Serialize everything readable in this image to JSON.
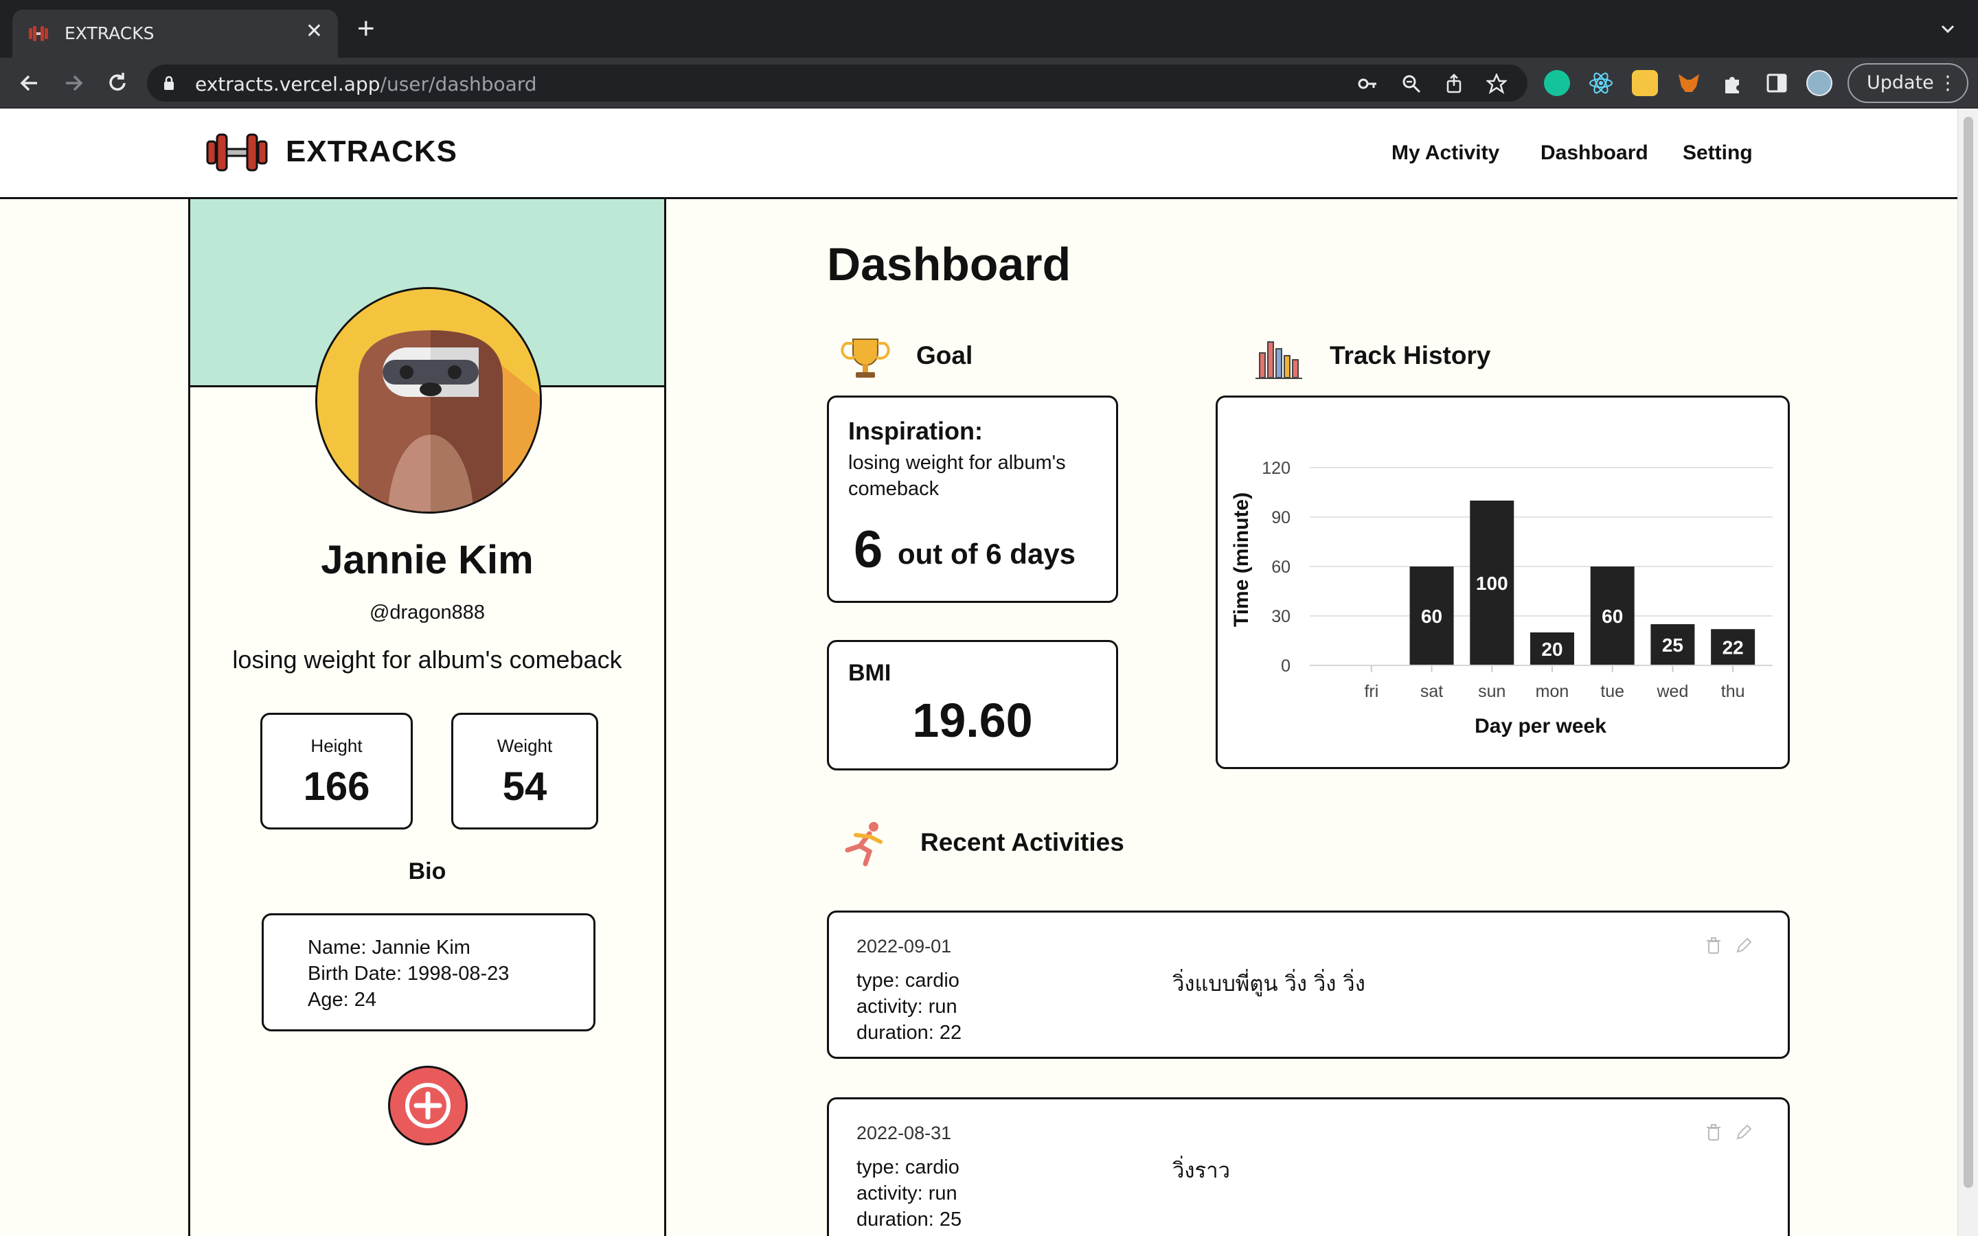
{
  "browser": {
    "tab_title": "EXTRACKS",
    "url_host": "extracts.vercel.app",
    "url_path": "/user/dashboard",
    "update_label": "Update"
  },
  "site": {
    "logo_text": "EXTRACKS",
    "nav": [
      "My Activity",
      "Dashboard",
      "Setting"
    ]
  },
  "profile": {
    "name": "Jannie Kim",
    "handle": "@dragon888",
    "inspiration": "losing weight for album's comeback",
    "height_label": "Height",
    "height_value": "166",
    "weight_label": "Weight",
    "weight_value": "54",
    "bio_title": "Bio",
    "bio_lines": [
      "Name: Jannie Kim",
      "Birth Date: 1998-08-23",
      "Age: 24"
    ]
  },
  "dashboard": {
    "title": "Dashboard",
    "goal_title": "Goal",
    "goal_heading": "Inspiration:",
    "goal_text": "losing weight for album's comeback",
    "goal_count": "6",
    "goal_rest": "out of 6 days",
    "bmi_label": "BMI",
    "bmi_value": "19.60",
    "track_title": "Track History",
    "recent_title": "Recent Activities"
  },
  "chart_data": {
    "type": "bar",
    "categories": [
      "fri",
      "sat",
      "sun",
      "mon",
      "tue",
      "wed",
      "thu"
    ],
    "values": [
      0,
      60,
      100,
      20,
      60,
      25,
      22
    ],
    "value_labels": [
      "",
      "60",
      "100",
      "20",
      "60",
      "25",
      "22"
    ],
    "xlabel": "Day per week",
    "ylabel": "Time (minute)",
    "yticks": [
      "0",
      "30",
      "60",
      "90",
      "120"
    ],
    "ylim": [
      0,
      120
    ],
    "grid": true,
    "bar_color": "#222222"
  },
  "activities": [
    {
      "date": "2022-09-01",
      "type": "type: cardio",
      "activity": "activity: run",
      "duration": "duration: 22",
      "note": "วิ่งแบบพี่ตูน วิ่ง วิ่ง วิ่ง"
    },
    {
      "date": "2022-08-31",
      "type": "type: cardio",
      "activity": "activity: run",
      "duration": "duration: 25",
      "note": "วิ่งราว"
    }
  ],
  "colors": {
    "banner": "#bde8d6",
    "add_button": "#e95b5b",
    "page_bg": "#fefef6"
  }
}
